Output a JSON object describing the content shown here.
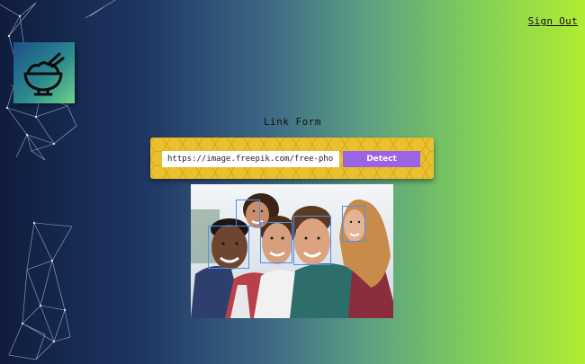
{
  "header": {
    "signout_label": "Sign Out"
  },
  "logo": {
    "icon": "rice-bowl-icon"
  },
  "form": {
    "title": "Link Form",
    "url_value": "https://image.freepik.com/free-photo/",
    "detect_label": "Detect"
  },
  "image": {
    "description_icon": "group-photo",
    "faces_detected": 5
  },
  "colors": {
    "form_bg": "#eac02e",
    "button": "#9b63e6",
    "face_box": "#4e8ef0"
  }
}
